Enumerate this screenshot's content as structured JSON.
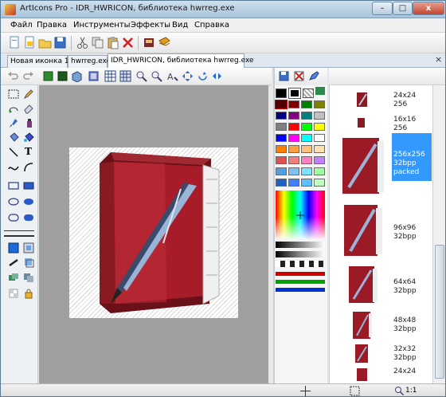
{
  "window": {
    "title": "ArtIcons Pro - IDR_HWRICON, библиотека hwrreg.exe",
    "minimize": "–",
    "maximize": "□",
    "close": "x"
  },
  "menu": [
    "Файл",
    "Правка",
    "Инструменты",
    "Эффекты",
    "Вид",
    "Справка"
  ],
  "tabs": [
    {
      "label": "Новая иконка 1"
    },
    {
      "label": "hwrreg.exe"
    },
    {
      "label": "IDR_HWRICON, библиотека hwrreg.exe",
      "active": true
    }
  ],
  "tab_close": "×",
  "text_tool": "T",
  "icon_sizes": [
    {
      "label": "24x24\n256"
    },
    {
      "label": "16x16\n256"
    },
    {
      "label": "256x256\n32bpp\npacked",
      "selected": true
    },
    {
      "label": "96x96\n32bpp"
    },
    {
      "label": "64x64\n32bpp"
    },
    {
      "label": "48x48\n32bpp"
    },
    {
      "label": "32x32\n32bpp"
    },
    {
      "label": "24x24"
    }
  ],
  "palette_colors": [
    "#800000",
    "#008000",
    "#808000",
    "#000080",
    "#800080",
    "#008080",
    "#c0c0c0",
    "#808080",
    "#ff0000",
    "#00ff00",
    "#ffff00",
    "#0000ff",
    "#ff00ff",
    "#00ffff",
    "#ffffff",
    "#ff8000",
    "#ffa040",
    "#ffc080",
    "#ffe0b0",
    "#e05050",
    "#f08080",
    "#ff80c0",
    "#c080ff",
    "#50a0e0",
    "#80c0f0",
    "#80e0ff",
    "#a0ffa0",
    "#2060c0",
    "#4080ff",
    "#60c0ff",
    "#c0ffc0"
  ],
  "status": {
    "zoom": "1:1"
  }
}
